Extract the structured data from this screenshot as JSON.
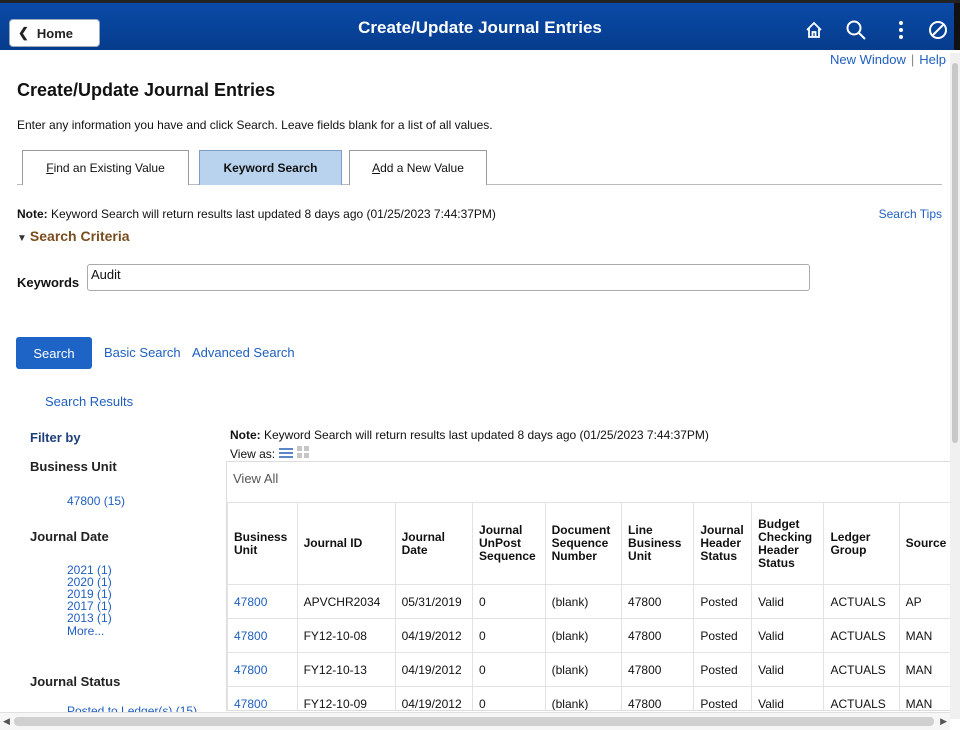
{
  "header": {
    "home_label": "Home",
    "title": "Create/Update Journal Entries",
    "icons": [
      "home-icon",
      "search-icon",
      "actions-menu-icon",
      "navbar-icon"
    ]
  },
  "top_links": {
    "new_window": "New Window",
    "separator": "|",
    "help": "Help"
  },
  "page": {
    "title": "Create/Update Journal Entries",
    "instructions": "Enter any information you have and click Search. Leave fields blank for a list of all values."
  },
  "tabs": [
    {
      "label": "Find an Existing Value",
      "accel": "F",
      "rest": "ind an Existing Value"
    },
    {
      "label": "Keyword Search",
      "active": true
    },
    {
      "label": "Add a New Value",
      "accel": "A",
      "rest": "dd a New Value"
    }
  ],
  "note": {
    "prefix": "Note:",
    "text": " Keyword Search will return results last updated 8 days ago (01/25/2023 7:44:37PM)"
  },
  "search_tips": "Search Tips",
  "search_criteria": {
    "label": "Search Criteria",
    "keywords_label": "Keywords",
    "keywords_value": "Audit"
  },
  "actions": {
    "search": "Search",
    "basic_search": "Basic Search",
    "advanced_search": "Advanced Search"
  },
  "results_link": "Search Results",
  "filters": {
    "title": "Filter by",
    "business_unit": {
      "label": "Business Unit",
      "values": [
        "47800 (15)"
      ]
    },
    "journal_date": {
      "label": "Journal Date",
      "values": [
        "2021 (1)",
        "2020 (1)",
        "2019 (1)",
        "2017 (1)",
        "2013 (1)"
      ],
      "more": "More..."
    },
    "journal_status": {
      "label": "Journal Status",
      "values": [
        "Posted to Ledger(s) (15)"
      ]
    }
  },
  "results": {
    "view_as": "View as:",
    "view_all": "View All",
    "columns": [
      "Business Unit",
      "Journal ID",
      "Journal Date",
      "Journal UnPost Sequence",
      "Document Sequence Number",
      "Line Business Unit",
      "Journal Header Status",
      "Budget Checking Header Status",
      "Ledger Group",
      "Source"
    ],
    "rows": [
      [
        "47800",
        "APVCHR2034",
        "05/31/2019",
        "0",
        "(blank)",
        "47800",
        "Posted",
        "Valid",
        "ACTUALS",
        "AP"
      ],
      [
        "47800",
        "FY12-10-08",
        "04/19/2012",
        "0",
        "(blank)",
        "47800",
        "Posted",
        "Valid",
        "ACTUALS",
        "MAN"
      ],
      [
        "47800",
        "FY12-10-13",
        "04/19/2012",
        "0",
        "(blank)",
        "47800",
        "Posted",
        "Valid",
        "ACTUALS",
        "MAN"
      ],
      [
        "47800",
        "FY12-10-09",
        "04/19/2012",
        "0",
        "(blank)",
        "47800",
        "Posted",
        "Valid",
        "ACTUALS",
        "MAN"
      ]
    ]
  },
  "colors": {
    "header": "#0a4aa8",
    "accent": "#1e63c6",
    "link": "#1f5fbf",
    "criteria": "#7a4d1e"
  }
}
